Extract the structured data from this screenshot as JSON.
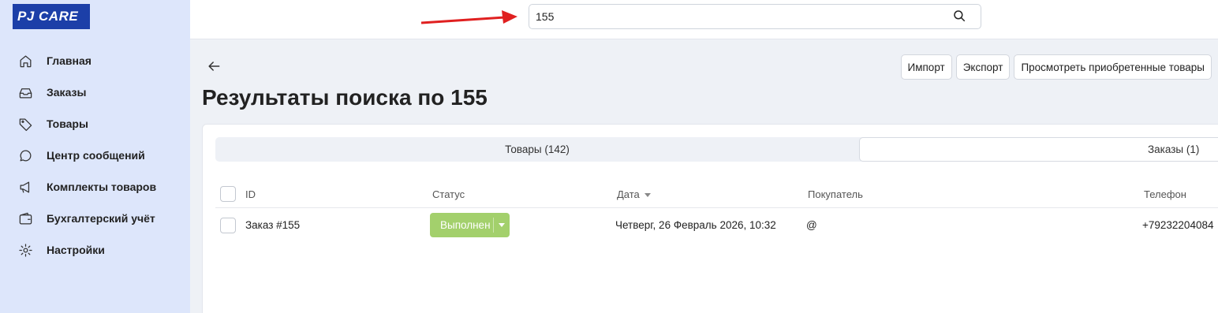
{
  "brand": {
    "logo_text": "PJ CARE",
    "logo_color": "#1c3fa8"
  },
  "sidebar": {
    "items": [
      {
        "label": "Главная",
        "icon": "home-icon"
      },
      {
        "label": "Заказы",
        "icon": "inbox-icon"
      },
      {
        "label": "Товары",
        "icon": "tag-icon"
      },
      {
        "label": "Центр сообщений",
        "icon": "chat-icon"
      },
      {
        "label": "Комплекты товаров",
        "icon": "megaphone-icon"
      },
      {
        "label": "Бухгалтерский учёт",
        "icon": "wallet-icon"
      },
      {
        "label": "Настройки",
        "icon": "gear-icon"
      }
    ]
  },
  "search": {
    "value": "155",
    "icon": "search-icon"
  },
  "annotation": {
    "arrow_color": "#e02020"
  },
  "toolbar": {
    "import_label": "Импорт",
    "export_label": "Экспорт",
    "view_purchased_label": "Просмотреть приобретенные товары"
  },
  "page": {
    "title": "Результаты поиска по 155"
  },
  "tabs": [
    {
      "label": "Товары (142)",
      "active": false
    },
    {
      "label": "Заказы (1)",
      "active": true
    }
  ],
  "table": {
    "columns": {
      "id": "ID",
      "status": "Статус",
      "date": "Дата",
      "buyer": "Покупатель",
      "phone": "Телефон"
    },
    "rows": [
      {
        "id": "Заказ #155",
        "status": "Выполнен",
        "status_color": "#a3d06c",
        "date": "Четверг, 26 Февраль 2026, 10:32",
        "buyer": "@",
        "phone": "+79232204084"
      }
    ]
  }
}
